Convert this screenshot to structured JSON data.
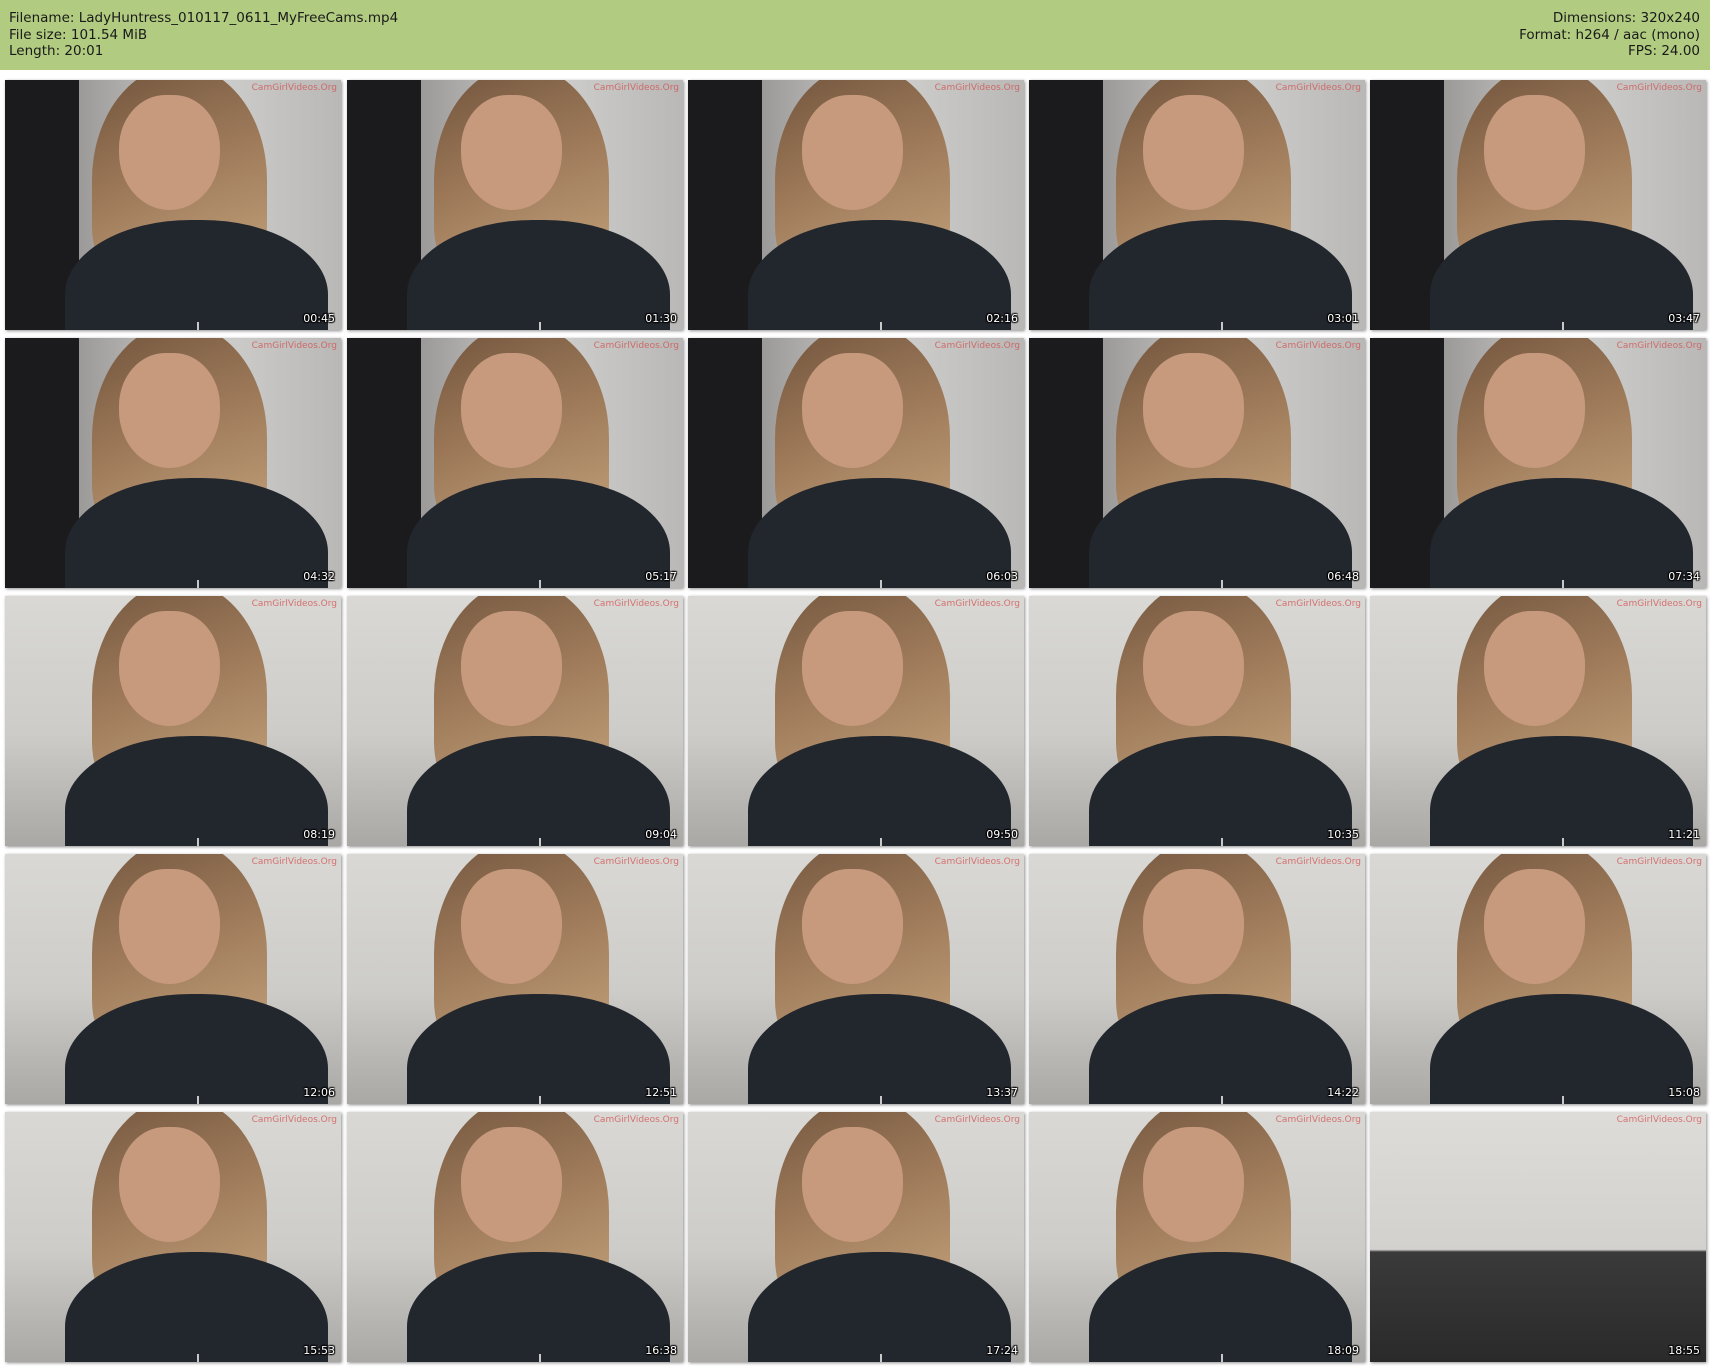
{
  "header": {
    "filename_line": "Filename: LadyHuntress_010117_0611_MyFreeCams.mp4",
    "filesize_line": "File size: 101.54 MiB",
    "length_line": "Length: 20:01",
    "dimensions_line": "Dimensions: 320x240",
    "format_line": "Format: h264 / aac (mono)",
    "fps_line": "FPS: 24.00"
  },
  "colors": {
    "header_bg": "#b1cc80",
    "page_bg": "#ffffff"
  },
  "watermark": "CamGirlVideos.Org",
  "thumbnails": [
    {
      "timestamp": "00:45",
      "scene": "curtain"
    },
    {
      "timestamp": "01:30",
      "scene": "curtain"
    },
    {
      "timestamp": "02:16",
      "scene": "curtain"
    },
    {
      "timestamp": "03:01",
      "scene": "curtain"
    },
    {
      "timestamp": "03:47",
      "scene": "curtain"
    },
    {
      "timestamp": "04:32",
      "scene": "curtain"
    },
    {
      "timestamp": "05:17",
      "scene": "curtain"
    },
    {
      "timestamp": "06:03",
      "scene": "curtain"
    },
    {
      "timestamp": "06:48",
      "scene": "curtain"
    },
    {
      "timestamp": "07:34",
      "scene": "curtain"
    },
    {
      "timestamp": "08:19",
      "scene": "room"
    },
    {
      "timestamp": "09:04",
      "scene": "room"
    },
    {
      "timestamp": "09:50",
      "scene": "room"
    },
    {
      "timestamp": "10:35",
      "scene": "room"
    },
    {
      "timestamp": "11:21",
      "scene": "room"
    },
    {
      "timestamp": "12:06",
      "scene": "room"
    },
    {
      "timestamp": "12:51",
      "scene": "room"
    },
    {
      "timestamp": "13:37",
      "scene": "room"
    },
    {
      "timestamp": "14:22",
      "scene": "room"
    },
    {
      "timestamp": "15:08",
      "scene": "room"
    },
    {
      "timestamp": "15:53",
      "scene": "room"
    },
    {
      "timestamp": "16:38",
      "scene": "room"
    },
    {
      "timestamp": "17:24",
      "scene": "room"
    },
    {
      "timestamp": "18:09",
      "scene": "room"
    },
    {
      "timestamp": "18:55",
      "scene": "bed"
    }
  ]
}
